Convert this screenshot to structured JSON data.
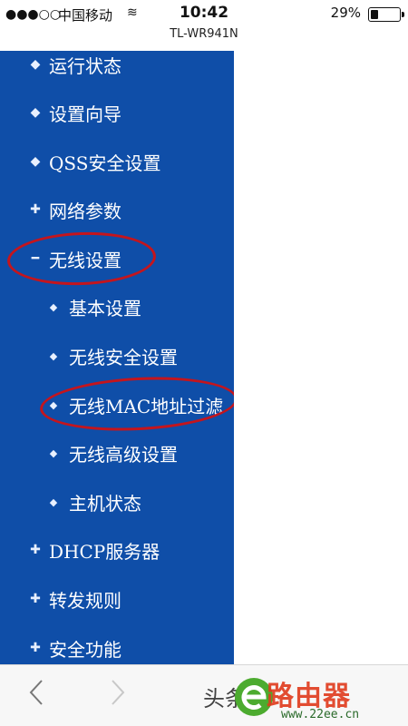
{
  "status_bar": {
    "signal": "●●●○○",
    "carrier": "中国移动",
    "wifi": "≋",
    "time": "10:42",
    "battery_percent": "29%",
    "battery_level": 0.29
  },
  "browser": {
    "page_title": "TL-WR941N",
    "back_icon": "chevron-left-icon",
    "forward_icon": "chevron-right-icon"
  },
  "menu": {
    "background": "#0f4ea8",
    "items": [
      {
        "label": "运行状态",
        "bullet": "◆",
        "level": "top"
      },
      {
        "label": "设置向导",
        "bullet": "◆",
        "level": "top"
      },
      {
        "label": "QSS安全设置",
        "bullet": "◆",
        "level": "top"
      },
      {
        "label": "网络参数",
        "bullet": "✚",
        "level": "top"
      },
      {
        "label": "无线设置",
        "bullet": "━",
        "level": "top",
        "highlighted": true
      },
      {
        "label": "基本设置",
        "bullet": "◆",
        "level": "sub"
      },
      {
        "label": "无线安全设置",
        "bullet": "◆",
        "level": "sub"
      },
      {
        "label": "无线MAC地址过滤",
        "bullet": "◆",
        "level": "sub",
        "highlighted": true
      },
      {
        "label": "无线高级设置",
        "bullet": "◆",
        "level": "sub"
      },
      {
        "label": "主机状态",
        "bullet": "◆",
        "level": "sub"
      },
      {
        "label": "DHCP服务器",
        "bullet": "✚",
        "level": "top"
      },
      {
        "label": "转发规则",
        "bullet": "✚",
        "level": "top"
      },
      {
        "label": "安全功能",
        "bullet": "✚",
        "level": "top"
      }
    ],
    "highlight_color": "#c4151d"
  },
  "watermark": {
    "logo_text": "路由器",
    "url": "www.22ee.cn",
    "side_text": "头条号"
  }
}
